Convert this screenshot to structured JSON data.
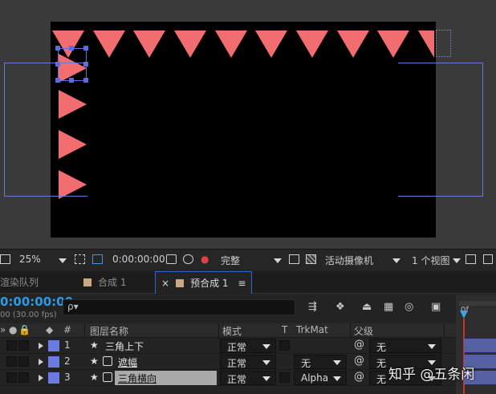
{
  "viewer": {
    "zoom": "25%",
    "timecode": "0:00:00:00",
    "resolution": "完整",
    "camera": "活动摄像机",
    "views": "1 个视图"
  },
  "tabs": [
    {
      "label": "渲染队列"
    },
    {
      "label": "合成 1"
    },
    {
      "label": "预合成 1",
      "menu": "≡",
      "close": "×"
    }
  ],
  "timeline": {
    "timecode": "0:00:00:00",
    "fps": "00 (30.00 fps)",
    "search_icon": "ρ▾",
    "ruler_label": "0f"
  },
  "columns": {
    "index": "#",
    "layer_name": "图层名称",
    "mode": "模式",
    "t": "T",
    "trkmat": "TrkMat",
    "parent": "父级"
  },
  "layers": [
    {
      "index": "1",
      "name": "三角上下",
      "mode": "正常",
      "trkmat": "",
      "parent": "无"
    },
    {
      "index": "2",
      "name": "遮幅",
      "mode": "正常",
      "trkmat": "无",
      "parent": "无"
    },
    {
      "index": "3",
      "name": "三角横向",
      "mode": "正常",
      "trkmat": "Alpha",
      "parent": "无"
    }
  ],
  "watermark": "知乎 @五条闲",
  "colors": {
    "triangle": "#f26d6f",
    "guide": "#6a78d6",
    "timecode": "#2d9be4",
    "layer_label": "#6b7be0"
  }
}
